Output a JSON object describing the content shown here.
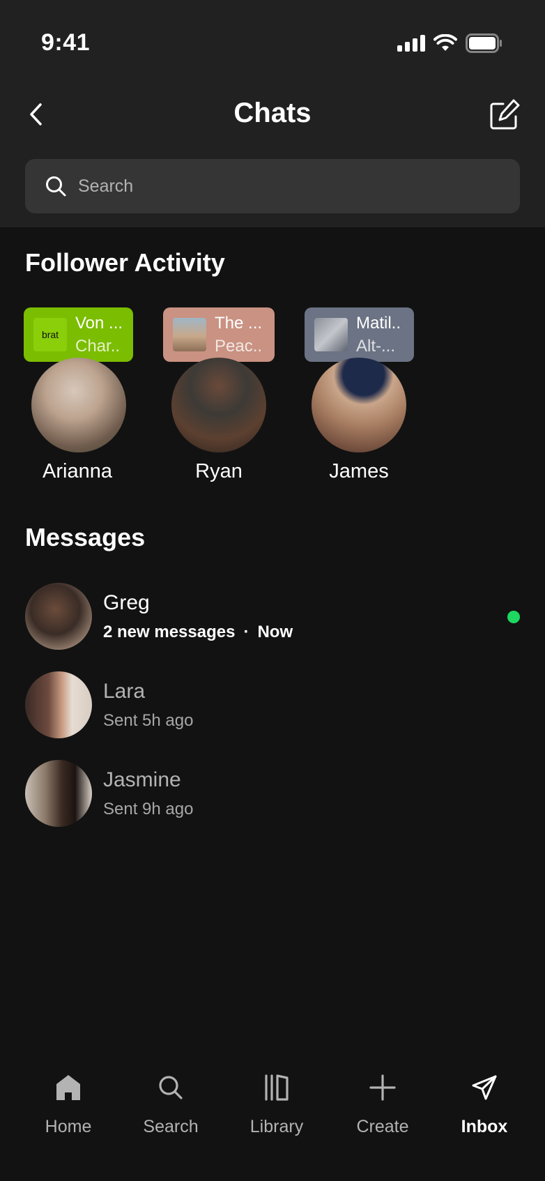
{
  "status_bar": {
    "time": "9:41"
  },
  "header": {
    "title": "Chats"
  },
  "search": {
    "placeholder": "Search"
  },
  "follower_activity": {
    "title": "Follower Activity",
    "items": [
      {
        "name": "Arianna",
        "line1": "Von ...",
        "line2": "Char..",
        "art_text": "brat",
        "chip_color": "#7bbd00"
      },
      {
        "name": "Ryan",
        "line1": "The ...",
        "line2": "Peac..",
        "art_text": "",
        "chip_color": "#c99282"
      },
      {
        "name": "James",
        "line1": "Matil..",
        "line2": "Alt-...",
        "art_text": "",
        "chip_color": "#6b7384"
      }
    ]
  },
  "messages": {
    "title": "Messages",
    "items": [
      {
        "name": "Greg",
        "status": "2 new messages",
        "time": "Now",
        "unread": true,
        "online": true
      },
      {
        "name": "Lara",
        "status": "Sent 5h ago",
        "unread": false
      },
      {
        "name": "Jasmine",
        "status": "Sent 9h ago",
        "unread": false
      }
    ]
  },
  "tab_bar": {
    "items": [
      {
        "label": "Home",
        "icon": "home-icon"
      },
      {
        "label": "Search",
        "icon": "search-icon"
      },
      {
        "label": "Library",
        "icon": "library-icon"
      },
      {
        "label": "Create",
        "icon": "plus-icon"
      },
      {
        "label": "Inbox",
        "icon": "send-icon",
        "active": true
      }
    ]
  },
  "colors": {
    "background": "#121212",
    "header": "#212121",
    "online": "#1ed760"
  }
}
